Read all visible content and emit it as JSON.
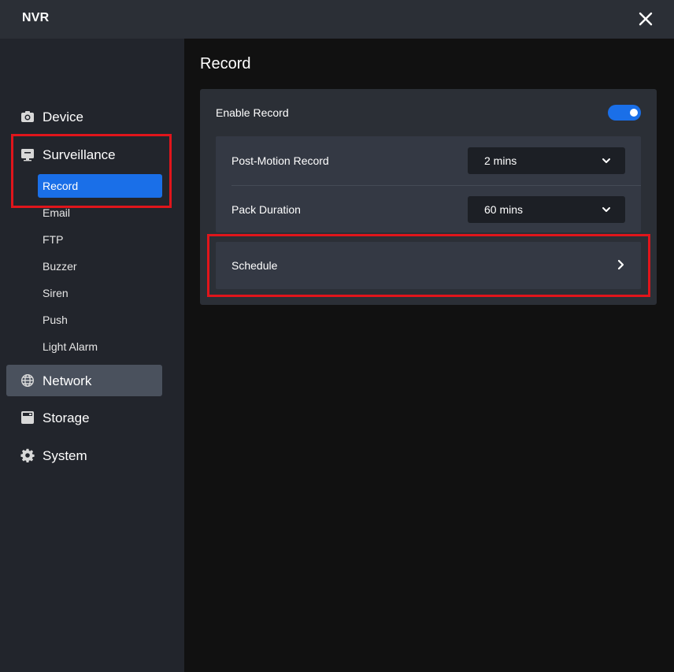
{
  "window": {
    "title": "NVR",
    "close_icon": "close-icon"
  },
  "sidebar": {
    "device": {
      "label": "Device",
      "icon": "camera-icon"
    },
    "surveillance": {
      "label": "Surveillance",
      "icon": "monitor-icon",
      "items": [
        {
          "label": "Record",
          "selected": true
        },
        {
          "label": "Email"
        },
        {
          "label": "FTP"
        },
        {
          "label": "Buzzer"
        },
        {
          "label": "Siren"
        },
        {
          "label": "Push"
        },
        {
          "label": "Light Alarm"
        }
      ]
    },
    "network": {
      "label": "Network",
      "icon": "globe-icon"
    },
    "storage": {
      "label": "Storage",
      "icon": "hard-drive-icon"
    },
    "system": {
      "label": "System",
      "icon": "gear-icon"
    }
  },
  "main": {
    "title": "Record",
    "enable_record": {
      "label": "Enable Record",
      "enabled": true
    },
    "post_motion": {
      "label": "Post-Motion Record",
      "value": "2 mins"
    },
    "pack_duration": {
      "label": "Pack Duration",
      "value": "60 mins"
    },
    "schedule": {
      "label": "Schedule"
    }
  },
  "colors": {
    "accent": "#1a6fe8",
    "highlight": "#e0151b",
    "sidebar_bg": "#22252c",
    "main_bg": "#111111",
    "panel_bg": "#2b2f36"
  }
}
